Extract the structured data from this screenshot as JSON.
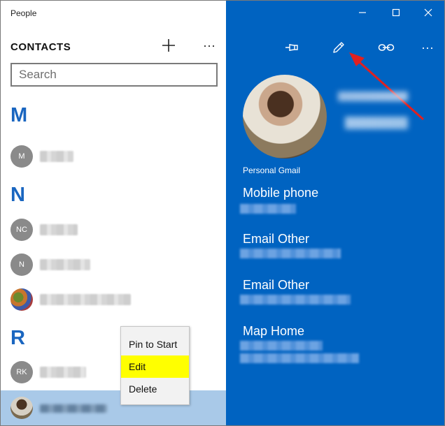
{
  "app": {
    "title": "People"
  },
  "sidebar": {
    "heading": "CONTACTS",
    "add_icon": "plus-icon",
    "more_icon": "ellipsis-icon",
    "search_placeholder": "Search",
    "groups": [
      {
        "letter": "M",
        "contacts": [
          {
            "initials": "M"
          }
        ]
      },
      {
        "letter": "N",
        "contacts": [
          {
            "initials": "NC"
          },
          {
            "initials": "N"
          },
          {
            "initials": ""
          }
        ]
      },
      {
        "letter": "R",
        "contacts": [
          {
            "initials": "RK"
          },
          {
            "initials": ""
          }
        ]
      }
    ]
  },
  "context_menu": {
    "items": [
      "Pin to Start",
      "Edit",
      "Delete"
    ],
    "highlighted": "Edit",
    "highlight_color": "#ffff00"
  },
  "detail": {
    "accent_color": "#0063c1",
    "toolbar_icons": [
      "pin-icon",
      "pencil-edit-icon",
      "link-icon",
      "ellipsis-icon"
    ],
    "account_label": "Personal Gmail",
    "fields": [
      "Mobile phone",
      "Email Other",
      "Email Other",
      "Map Home"
    ]
  }
}
